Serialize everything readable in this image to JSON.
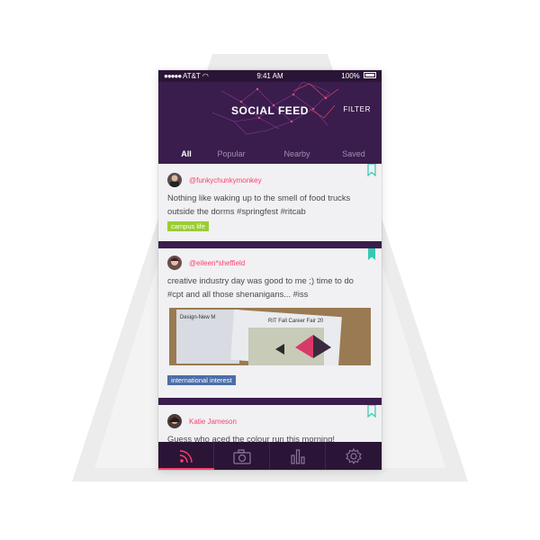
{
  "status_bar": {
    "carrier": "AT&T",
    "time": "9:41 AM",
    "battery": "100%"
  },
  "header": {
    "title": "SOCIAL FEED",
    "filter_label": "FILTER"
  },
  "tabs": [
    {
      "label": "All",
      "active": true
    },
    {
      "label": "Popular",
      "active": false
    },
    {
      "label": "Nearby",
      "active": false
    },
    {
      "label": "Saved",
      "active": false
    }
  ],
  "posts": [
    {
      "handle": "@funkychunkymonkey",
      "text": "Nothing like waking up to the smell of food trucks outside the dorms #springfest #ritcab",
      "tag": "campus life",
      "tag_color": "#9acd32",
      "bookmarked": false
    },
    {
      "handle": "@eileen*sheffield",
      "text": "creative industry day was good to me ;) time to do #cpt and all those shenanigans... #iss",
      "tag": "international interest",
      "tag_color": "#4c6ea8",
      "bookmarked": true,
      "photo_caption_1": "Design-New M",
      "photo_caption_2": "RIT Fall Career Fair 20"
    },
    {
      "handle": "Katie Jameson",
      "text": "Guess who aced the colour run this morning!",
      "bookmarked": false
    }
  ],
  "tabbar": [
    {
      "icon": "feed-icon",
      "active": true
    },
    {
      "icon": "camera-icon",
      "active": false
    },
    {
      "icon": "stats-icon",
      "active": false
    },
    {
      "icon": "settings-icon",
      "active": false
    }
  ],
  "colors": {
    "accent": "#ff3f6f",
    "header_bg": "#3a1d4c",
    "tabbar_bg": "#2b1537",
    "bookmark": "#33c9b4"
  }
}
